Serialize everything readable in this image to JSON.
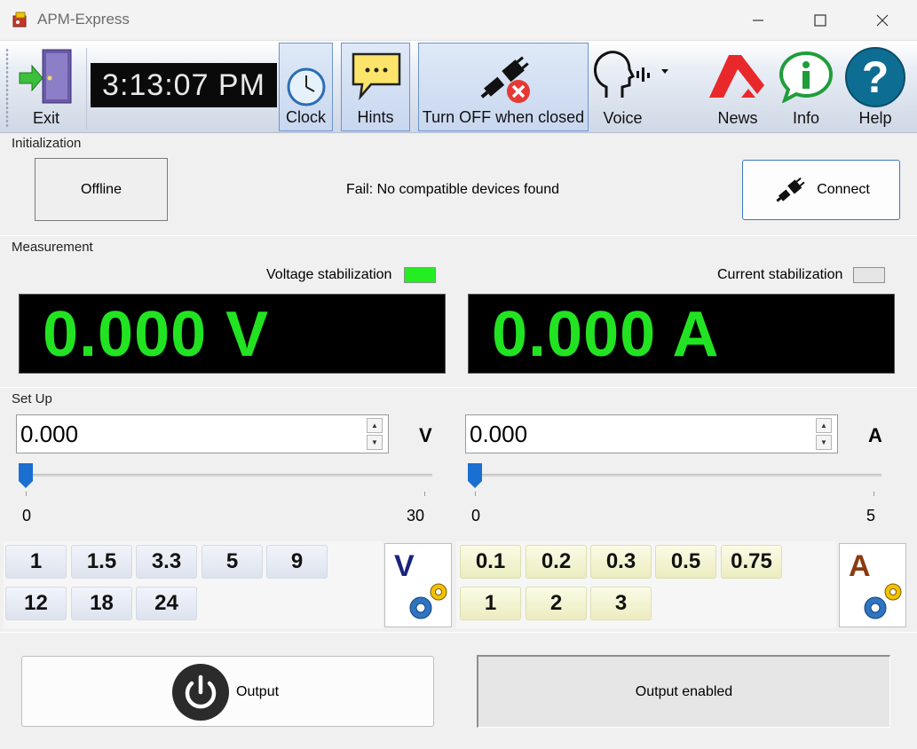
{
  "window": {
    "title": "APM-Express"
  },
  "toolbar": {
    "exit_label": "Exit",
    "time": "3:13:07 PM",
    "clock_label": "Clock",
    "hints_label": "Hints",
    "turn_off_label": "Turn OFF when closed",
    "voice_label": "Voice",
    "news_label": "News",
    "info_label": "Info",
    "help_label": "Help"
  },
  "initialization": {
    "group_label": "Initialization",
    "state": "Offline",
    "message": "Fail: No compatible devices found",
    "connect_label": "Connect"
  },
  "measurement": {
    "group_label": "Measurement",
    "voltage_stab_label": "Voltage stabilization",
    "voltage_stab_color": "#22ee22",
    "current_stab_label": "Current stabilization",
    "current_stab_color": "#e6e6e6",
    "voltage_display": "0.000 V",
    "current_display": "0.000 A",
    "display_color": "#22e322"
  },
  "setup": {
    "group_label": "Set Up",
    "voltage_value": "0.000",
    "voltage_unit": "V",
    "voltage_min": "0",
    "voltage_max": "30",
    "voltage_slider_level": 0,
    "current_value": "0.000",
    "current_unit": "A",
    "current_min": "0",
    "current_max": "5",
    "current_slider_level": 0,
    "voltage_presets": [
      "1",
      "1.5",
      "3.3",
      "5",
      "9",
      "12",
      "18",
      "24"
    ],
    "current_presets": [
      "0.1",
      "0.2",
      "0.3",
      "0.5",
      "0.75",
      "1",
      "2",
      "3"
    ],
    "voltage_config_letter": "V",
    "current_config_letter": "A"
  },
  "output": {
    "button_label": "Output",
    "status": "Output enabled"
  },
  "colors": {
    "accent_blue": "#3a78c2",
    "slider_blue": "#1a6fd0"
  }
}
